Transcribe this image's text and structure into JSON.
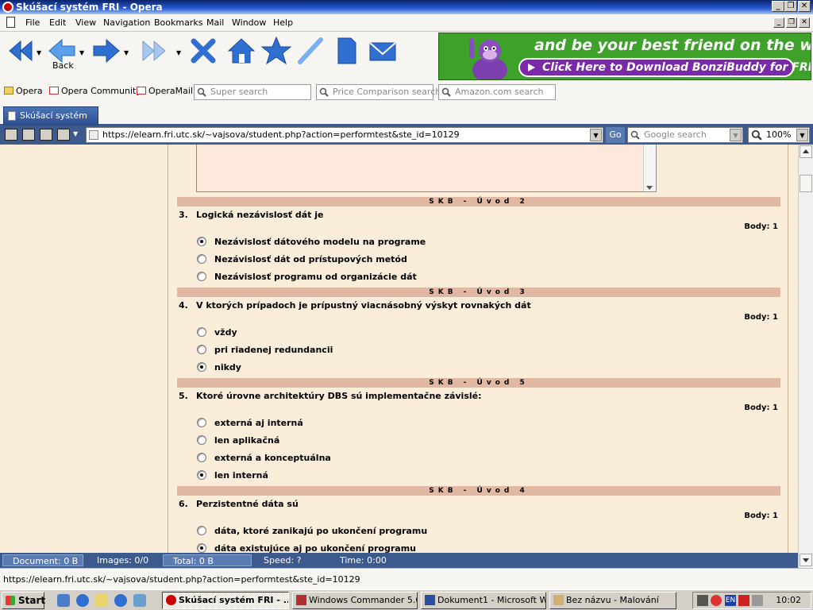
{
  "window": {
    "title": "Skúšací systém FRI - Opera"
  },
  "menu": [
    "File",
    "Edit",
    "View",
    "Navigation",
    "Bookmarks",
    "Mail",
    "Window",
    "Help"
  ],
  "toolbar": {
    "back_label": "Back"
  },
  "ad": {
    "headline": "and be your best friend on the web!",
    "cta": "Click Here to Download BonziBuddy for FREE!"
  },
  "personal_bar": {
    "links": [
      "Opera",
      "Opera Community",
      "OperaMail"
    ],
    "searches": [
      "Super search",
      "Price Comparison search",
      "Amazon.com search"
    ]
  },
  "tab": {
    "label": "Skúšací systém FRI"
  },
  "address": {
    "url": "https://elearn.fri.utc.sk/~vajsova/student.php?action=performtest&ste_id=10129",
    "go": "Go",
    "search_placeholder": "Google search",
    "zoom": "100%"
  },
  "questions": [
    {
      "section": "SKB - Úvod 2",
      "number": "3.",
      "text": "Logická nezávislosť dát je",
      "points": "Body: 1",
      "options": [
        {
          "label": "Nezávislosť dátového modelu na programe",
          "selected": true
        },
        {
          "label": "Nezávislosť dát od prístupových metód",
          "selected": false
        },
        {
          "label": "Nezávislosť programu od organizácie dát",
          "selected": false
        }
      ]
    },
    {
      "section": "SKB - Úvod 3",
      "number": "4.",
      "text": "V ktorých prípadoch je prípustný viacnásobný výskyt rovnakých dát",
      "points": "Body: 1",
      "options": [
        {
          "label": "vždy",
          "selected": false
        },
        {
          "label": "pri riadenej redundancii",
          "selected": false
        },
        {
          "label": "nikdy",
          "selected": true
        }
      ]
    },
    {
      "section": "SKB - Úvod 5",
      "number": "5.",
      "text": "Ktoré úrovne architektúry DBS sú implementačne závislé:",
      "points": "Body: 1",
      "options": [
        {
          "label": "externá aj interná",
          "selected": false
        },
        {
          "label": "len aplikačná",
          "selected": false
        },
        {
          "label": "externá a konceptuálna",
          "selected": false
        },
        {
          "label": "len interná",
          "selected": true
        }
      ]
    },
    {
      "section": "SKB - Úvod 4",
      "number": "6.",
      "text": "Perzistentné dáta sú",
      "points": "Body: 1",
      "options": [
        {
          "label": "dáta, ktoré zanikajú po ukončení programu",
          "selected": false
        },
        {
          "label": "dáta existujúce aj po ukončení programu",
          "selected": true
        }
      ]
    }
  ],
  "status": {
    "document": "Document:   0 B",
    "images": "Images:   0/0",
    "total": "Total:    0 B",
    "speed": "Speed:   ?",
    "time": "Time:    0:00"
  },
  "status_url": "https://elearn.fri.utc.sk/~vajsova/student.php?action=performtest&ste_id=10129",
  "taskbar": {
    "start": "Start",
    "tasks": [
      "Skúšací systém FRI - ...",
      "Windows Commander 5.0...",
      "Dokument1 - Microsoft W...",
      "Bez názvu - Malování"
    ],
    "tray_lang": "EN",
    "clock": "10:02"
  }
}
